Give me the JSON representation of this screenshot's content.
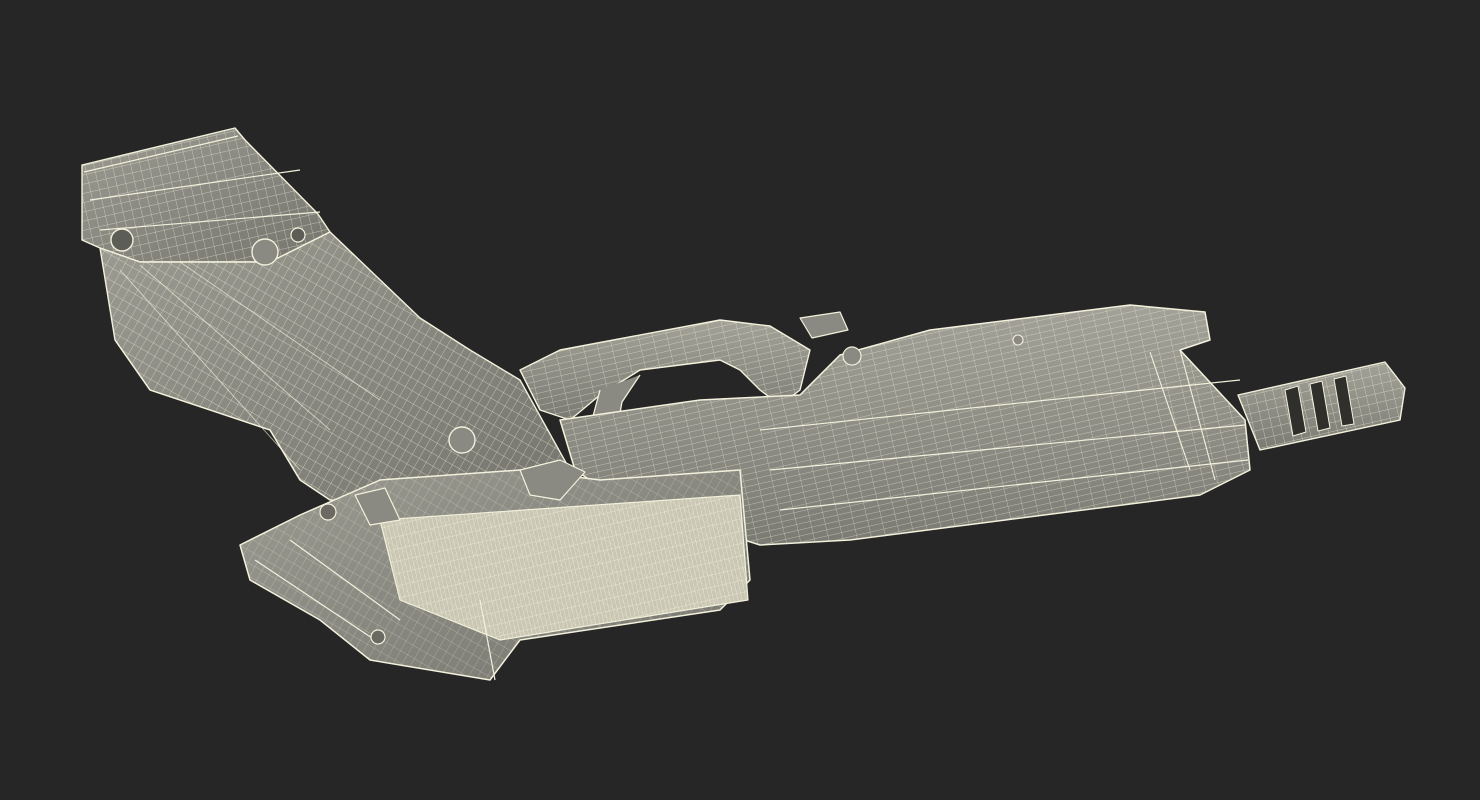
{
  "scene": {
    "subject": "pistol-wireframe-model",
    "background_color": "#262626",
    "mesh_fill_color": "#8f8f86",
    "mesh_fill_light": "#b3b2a6",
    "mesh_fill_dark": "#6a6a63",
    "wire_color": "#f3f1dc"
  }
}
